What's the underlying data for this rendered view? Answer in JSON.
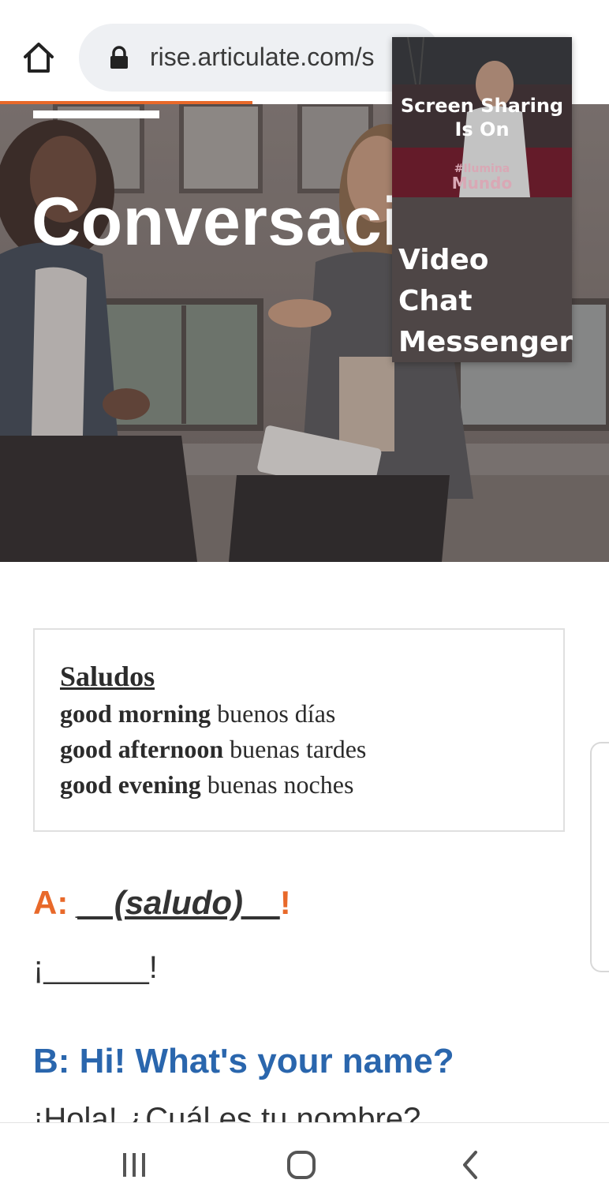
{
  "browser": {
    "url": "rise.articulate.com/s",
    "icons": {
      "home": "home-icon",
      "lock": "lock-icon"
    },
    "progress_color": "#e8692a"
  },
  "hero": {
    "title": "Conversació"
  },
  "overlay": {
    "video_status": "Screen Sharing Is On",
    "video_logo_line1": "#Ilumina",
    "video_logo_line2": "Mundo",
    "chat_label": "Video Chat Messenger"
  },
  "vocab": {
    "heading": "Saludos",
    "rows": [
      {
        "english": "good morning",
        "spanish": "buenos días"
      },
      {
        "english": "good afternoon",
        "spanish": "buenas tardes"
      },
      {
        "english": "good evening",
        "spanish": "buenas noches"
      }
    ]
  },
  "dialogue": {
    "a_label": "A: ",
    "a_blank": "__(saludo)__",
    "a_end": "!",
    "a_response": "¡______!",
    "b_label": "B: Hi! What's your name?",
    "b_response": "¡Hola! ¿Cuál es tu nombre?"
  },
  "colors": {
    "accent_orange": "#e8692a",
    "accent_blue": "#2a66ad",
    "overlay_bg": "#4e4646"
  },
  "navbar": {
    "icons": [
      "recent-apps-icon",
      "home-circle-icon",
      "back-icon"
    ]
  }
}
